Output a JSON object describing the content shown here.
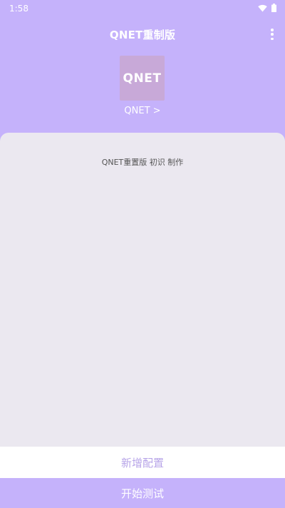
{
  "status_bar": {
    "time": "1:58",
    "wifi_icon": "wifi-icon",
    "battery_icon": "battery-icon"
  },
  "app_bar": {
    "title": "QNET重制版",
    "menu_icon": "more-vert-icon"
  },
  "logo": {
    "text": "QNET"
  },
  "node_link": {
    "label": "QNET >"
  },
  "content": {
    "credits": "QNET重置版 初识 制作"
  },
  "buttons": {
    "add_config": "新增配置",
    "start_test": "开始测试"
  },
  "colors": {
    "primary": "#c5b2fb",
    "content_bg": "#ebe8f0",
    "logo_bg": "#c8a9d8",
    "add_config_text": "#b7a4e8"
  }
}
